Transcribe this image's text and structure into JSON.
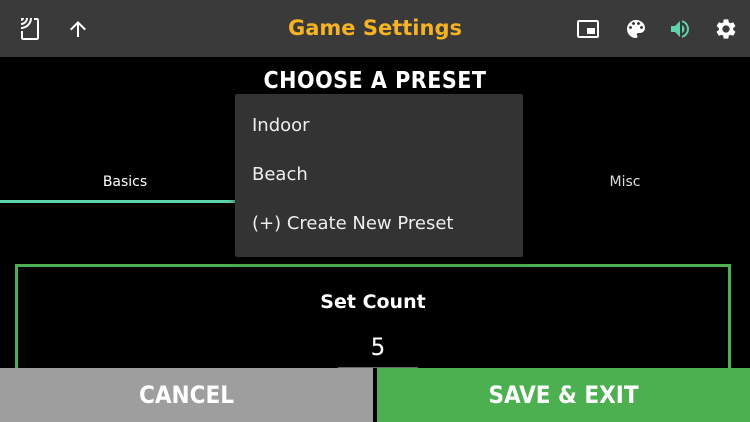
{
  "header": {
    "title": "Game Settings",
    "icons": {
      "cast": "cast-icon",
      "up": "arrow-up-icon",
      "pip": "picture-in-picture-icon",
      "palette": "palette-icon",
      "sound": "volume-icon",
      "settings": "gear-icon"
    },
    "colors": {
      "title": "#f5b324",
      "bar": "#3a3a3a",
      "sound_icon": "#5fd3a9"
    }
  },
  "preset": {
    "heading": "CHOOSE A PRESET",
    "options": [
      "Indoor",
      "Beach",
      "(+) Create New Preset"
    ]
  },
  "tabs": [
    {
      "label": "Basics",
      "active": true
    },
    {
      "label": "Misc",
      "active": false
    }
  ],
  "panel": {
    "label": "Set Count",
    "value": "5"
  },
  "buttons": {
    "cancel": "CANCEL",
    "save": "SAVE & EXIT"
  }
}
